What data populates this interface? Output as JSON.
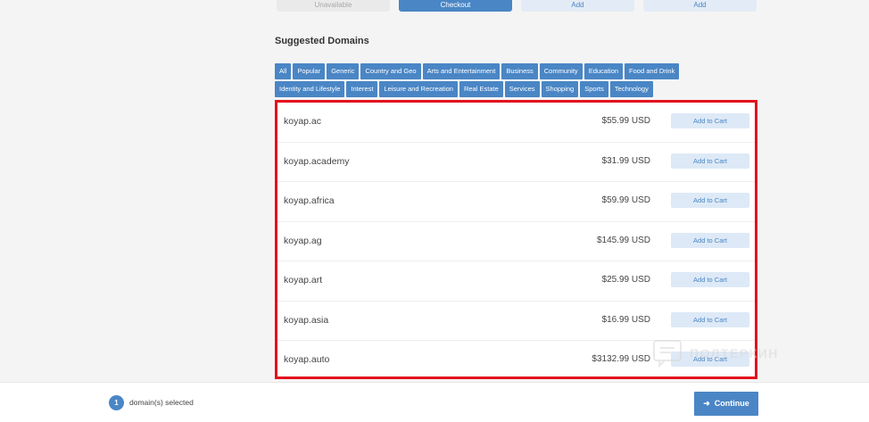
{
  "top_buttons": {
    "unavailable": "Unavailable",
    "checkout": "Checkout",
    "add_1": "Add",
    "add_2": "Add"
  },
  "suggested": {
    "title": "Suggested Domains",
    "filters_row1": [
      "All",
      "Popular",
      "Generic",
      "Country and Geo",
      "Arts and Entertainment",
      "Business",
      "Community",
      "Education",
      "Food and Drink"
    ],
    "filters_row2": [
      "Identity and Lifestyle",
      "Interest",
      "Leisure and Recreation",
      "Real Estate",
      "Services",
      "Shopping",
      "Sports",
      "Technology"
    ],
    "results": [
      {
        "domain": "koyap.ac",
        "price": "$55.99 USD",
        "action": "Add to Cart"
      },
      {
        "domain": "koyap.academy",
        "price": "$31.99 USD",
        "action": "Add to Cart"
      },
      {
        "domain": "koyap.africa",
        "price": "$59.99 USD",
        "action": "Add to Cart"
      },
      {
        "domain": "koyap.ag",
        "price": "$145.99 USD",
        "action": "Add to Cart"
      },
      {
        "domain": "koyap.art",
        "price": "$25.99 USD",
        "action": "Add to Cart"
      },
      {
        "domain": "koyap.asia",
        "price": "$16.99 USD",
        "action": "Add to Cart"
      },
      {
        "domain": "koyap.auto",
        "price": "$3132.99 USD",
        "action": "Add to Cart"
      }
    ],
    "highlight_color": "#e3101c"
  },
  "watermark": {
    "text": "ПОЛТЕРКИН"
  },
  "footer": {
    "count": "1",
    "selected_label": "domain(s) selected",
    "continue_label": "Continue",
    "continue_icon": "arrow-right-icon"
  },
  "colors": {
    "accent": "#4a86c5",
    "light_accent": "#dde9f6"
  }
}
